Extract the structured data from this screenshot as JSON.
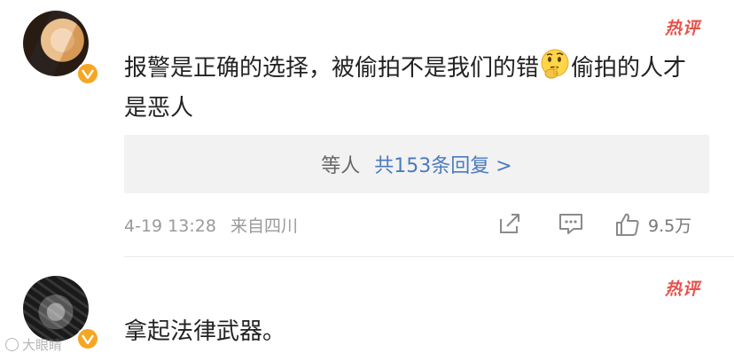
{
  "comments": [
    {
      "hot_tag": "热评",
      "text_before": "报警是正确的选择，被偷拍不是我们的错",
      "emoji": "thinking-face",
      "text_after": "偷拍的人才是恶人",
      "reply_box": {
        "prefix": "等人",
        "link": "共153条回复 >"
      },
      "date": "4-19 13:28",
      "source": "来自四川",
      "like_count": "9.5万"
    },
    {
      "hot_tag": "热评",
      "text": "拿起法律武器。"
    }
  ],
  "watermark": "大眼睛"
}
